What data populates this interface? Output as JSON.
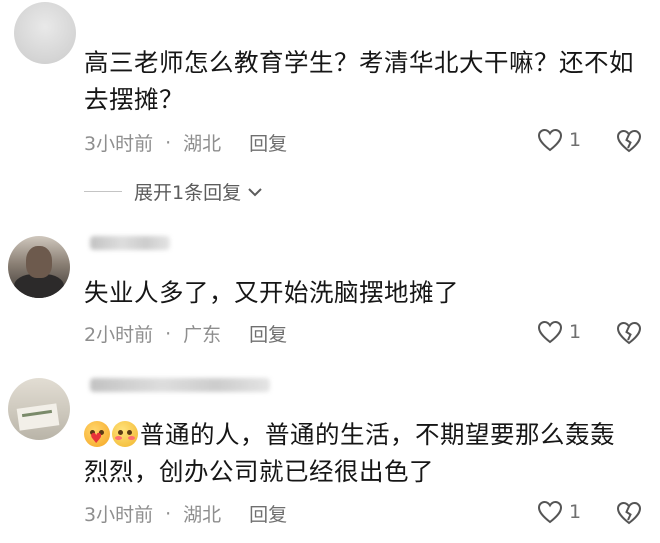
{
  "comments": [
    {
      "text_line1": "高三老师怎么教育学生？考清华北大干嘛？还不如",
      "text_line2": "去摆摊？",
      "time": "3小时前",
      "dot": "·",
      "location": "湖北",
      "reply": "回复",
      "likes": "1"
    },
    {
      "text_line1": "失业人多了，又开始洗脑摆地摊了",
      "time": "2小时前",
      "dot": "·",
      "location": "广东",
      "reply": "回复",
      "likes": "1"
    },
    {
      "text_line1": "普通的人，普通的生活，不期望要那么轰轰",
      "text_line2": "烈烈，创办公司就已经很出色了",
      "time": "3小时前",
      "dot": "·",
      "location": "湖北",
      "reply": "回复",
      "likes": "1"
    }
  ],
  "expand_replies": "展开1条回复",
  "icons": {
    "like": "heart-outline-icon",
    "dislike": "broken-heart-icon",
    "expand": "chevron-down-icon"
  },
  "colors": {
    "text": "#161616",
    "meta": "#8e8e8e",
    "icon": "#555555"
  }
}
